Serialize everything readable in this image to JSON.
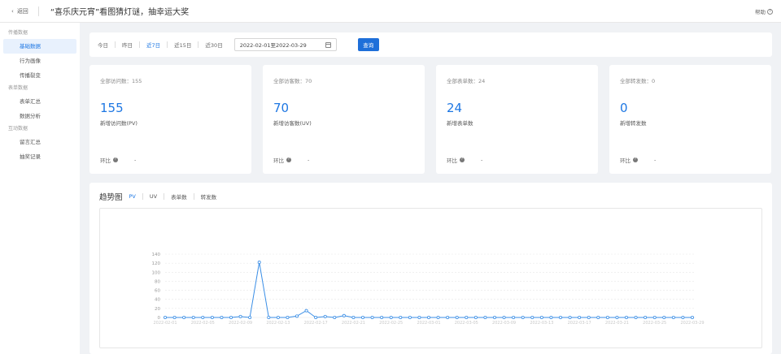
{
  "header": {
    "back_label": "返回",
    "title": "“喜乐庆元宵”看图猜灯谜，抽幸运大奖",
    "help_label": "帮助"
  },
  "sidebar": {
    "groups": [
      {
        "label": "传播数据",
        "items": [
          {
            "label": "基础数据",
            "active": true
          },
          {
            "label": "行为画像"
          },
          {
            "label": "传播裂变"
          }
        ]
      },
      {
        "label": "表单数据",
        "items": [
          {
            "label": "表单汇总"
          },
          {
            "label": "数据分析"
          }
        ]
      },
      {
        "label": "互动数据",
        "items": [
          {
            "label": "留言汇总"
          },
          {
            "label": "抽奖记录"
          }
        ]
      }
    ]
  },
  "filter": {
    "tabs": [
      "今日",
      "昨日",
      "近7日",
      "近15日",
      "近30日"
    ],
    "active_tab": "近7日",
    "date_range": "2022-02-01至2022-03-29",
    "query_label": "查询"
  },
  "cards": [
    {
      "total_label": "全部访问数：155",
      "value": "155",
      "sub_label": "新增访问数(PV)",
      "ratio_label": "环比",
      "ratio_value": "-"
    },
    {
      "total_label": "全部访客数：70",
      "value": "70",
      "sub_label": "新增访客数(UV)",
      "ratio_label": "环比",
      "ratio_value": "-"
    },
    {
      "total_label": "全部表单数：24",
      "value": "24",
      "sub_label": "新增表单数",
      "ratio_label": "环比",
      "ratio_value": "-"
    },
    {
      "total_label": "全部转发数：0",
      "value": "0",
      "sub_label": "新增转发数",
      "ratio_label": "环比",
      "ratio_value": "-"
    }
  ],
  "trend": {
    "title": "趋势图",
    "tabs": [
      "PV",
      "UV",
      "表单数",
      "转发数"
    ],
    "active_tab": "PV"
  },
  "colors": {
    "accent": "#1e77e3",
    "button": "#1e6fd9",
    "line": "#3a8ee6"
  },
  "chart_data": {
    "type": "line",
    "ylim": [
      0,
      140
    ],
    "yticks": [
      0,
      20,
      40,
      60,
      80,
      100,
      120,
      140
    ],
    "x": [
      "2022-02-01",
      "2022-02-02",
      "2022-02-03",
      "2022-02-04",
      "2022-02-05",
      "2022-02-06",
      "2022-02-07",
      "2022-02-08",
      "2022-02-09",
      "2022-02-10",
      "2022-02-11",
      "2022-02-12",
      "2022-02-13",
      "2022-02-14",
      "2022-02-15",
      "2022-02-16",
      "2022-02-17",
      "2022-02-18",
      "2022-02-19",
      "2022-02-20",
      "2022-02-21",
      "2022-02-22",
      "2022-02-23",
      "2022-02-24",
      "2022-02-25",
      "2022-02-26",
      "2022-02-27",
      "2022-02-28",
      "2022-03-01",
      "2022-03-02",
      "2022-03-03",
      "2022-03-04",
      "2022-03-05",
      "2022-03-06",
      "2022-03-07",
      "2022-03-08",
      "2022-03-09",
      "2022-03-10",
      "2022-03-11",
      "2022-03-12",
      "2022-03-13",
      "2022-03-14",
      "2022-03-15",
      "2022-03-16",
      "2022-03-17",
      "2022-03-18",
      "2022-03-19",
      "2022-03-20",
      "2022-03-21",
      "2022-03-22",
      "2022-03-23",
      "2022-03-24",
      "2022-03-25",
      "2022-03-26",
      "2022-03-27",
      "2022-03-28",
      "2022-03-29"
    ],
    "xticks": [
      "2022-02-01",
      "2022-02-05",
      "2022-02-09",
      "2022-02-13",
      "2022-02-17",
      "2022-02-21",
      "2022-02-25",
      "2022-03-01",
      "2022-03-05",
      "2022-03-09",
      "2022-03-13",
      "2022-03-17",
      "2022-03-21",
      "2022-03-25",
      "2022-03-29"
    ],
    "series": [
      {
        "values": [
          0,
          0,
          0,
          0,
          0,
          0,
          0,
          0,
          2,
          0,
          122,
          0,
          0,
          0,
          3,
          15,
          0,
          2,
          0,
          4,
          0,
          0,
          0,
          0,
          0,
          0,
          0,
          0,
          0,
          0,
          0,
          0,
          0,
          0,
          0,
          0,
          0,
          0,
          0,
          0,
          0,
          0,
          0,
          0,
          0,
          0,
          0,
          0,
          0,
          0,
          0,
          0,
          0,
          0,
          0,
          0,
          0
        ]
      }
    ]
  }
}
